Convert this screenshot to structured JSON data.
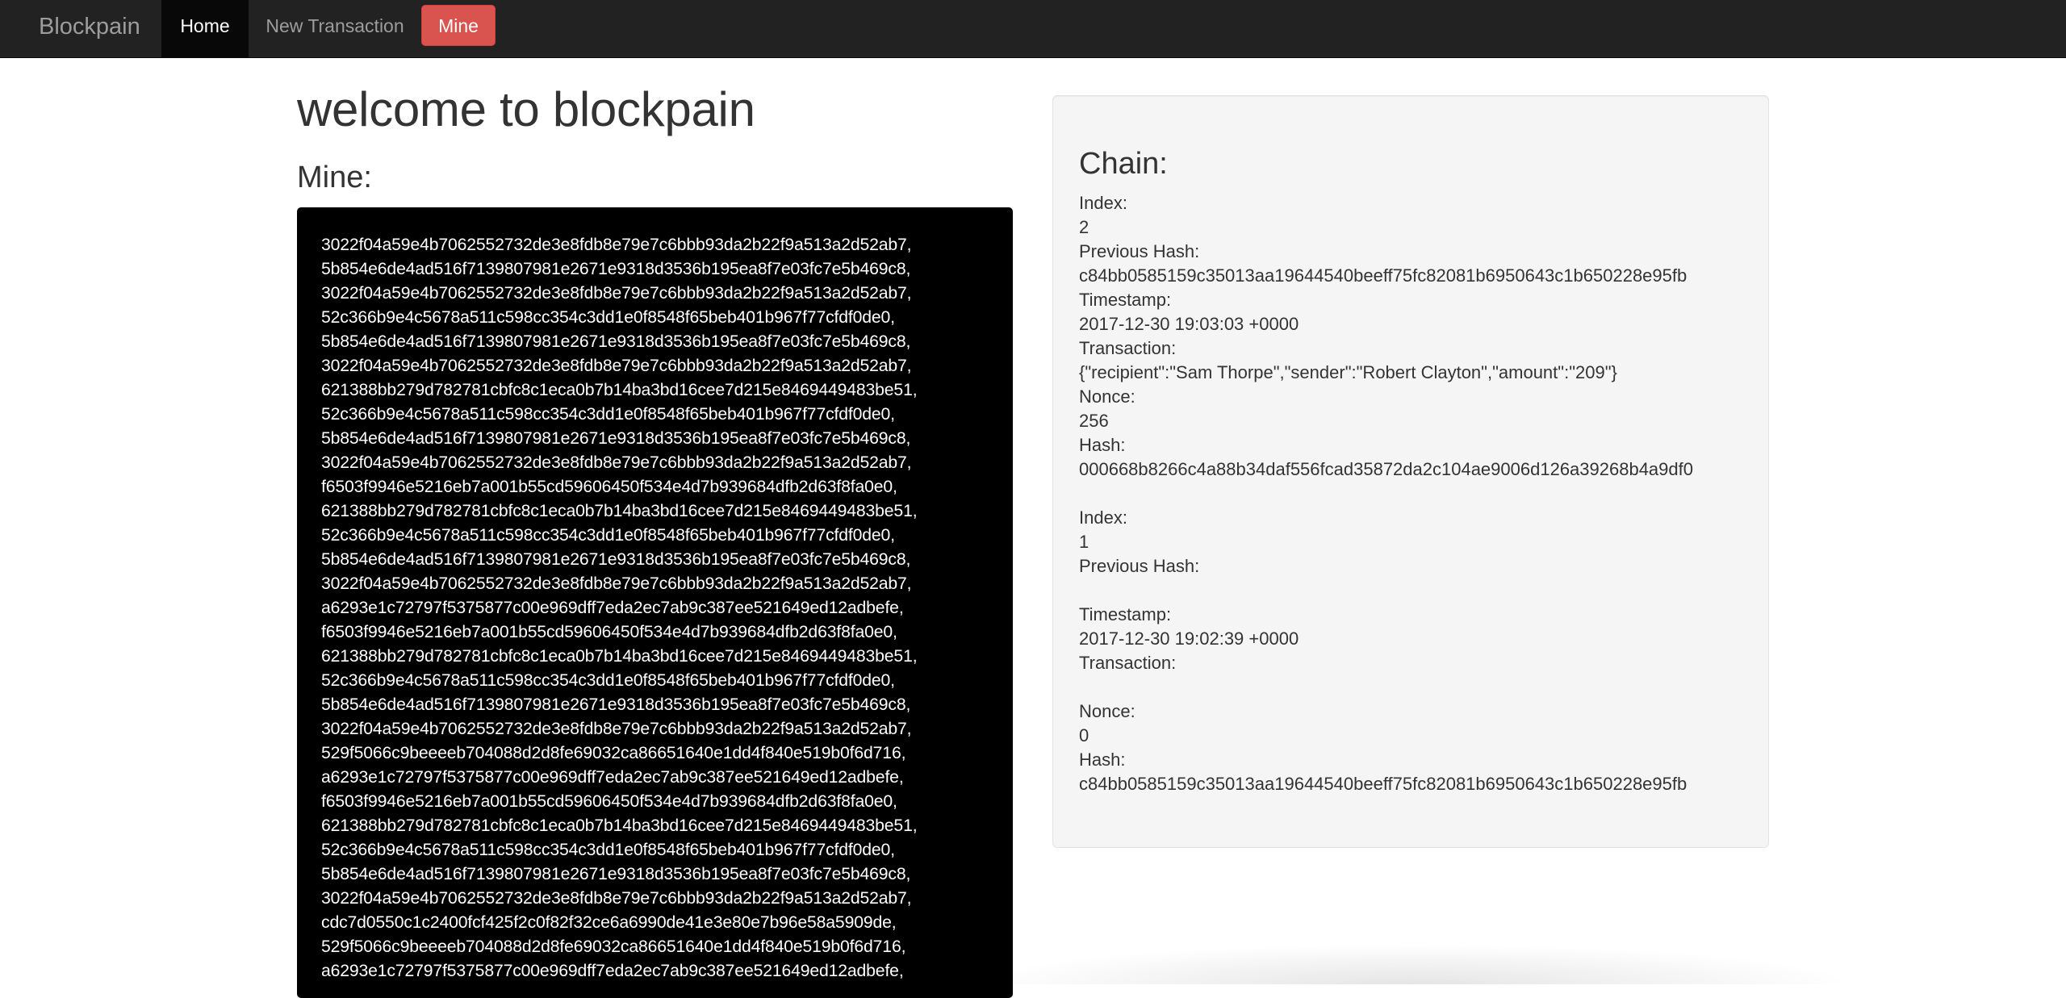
{
  "navbar": {
    "brand": "Blockpain",
    "home_label": "Home",
    "new_transaction_label": "New Transaction",
    "mine_label": "Mine"
  },
  "main": {
    "title": "welcome to blockpain",
    "mine_heading": "Mine:",
    "mine_hashes": [
      "3022f04a59e4b7062552732de3e8fdb8e79e7c6bbb93da2b22f9a513a2d52ab7,",
      "5b854e6de4ad516f7139807981e2671e9318d3536b195ea8f7e03fc7e5b469c8,",
      "3022f04a59e4b7062552732de3e8fdb8e79e7c6bbb93da2b22f9a513a2d52ab7,",
      "52c366b9e4c5678a511c598cc354c3dd1e0f8548f65beb401b967f77cfdf0de0,",
      "5b854e6de4ad516f7139807981e2671e9318d3536b195ea8f7e03fc7e5b469c8,",
      "3022f04a59e4b7062552732de3e8fdb8e79e7c6bbb93da2b22f9a513a2d52ab7,",
      "621388bb279d782781cbfc8c1eca0b7b14ba3bd16cee7d215e8469449483be51,",
      "52c366b9e4c5678a511c598cc354c3dd1e0f8548f65beb401b967f77cfdf0de0,",
      "5b854e6de4ad516f7139807981e2671e9318d3536b195ea8f7e03fc7e5b469c8,",
      "3022f04a59e4b7062552732de3e8fdb8e79e7c6bbb93da2b22f9a513a2d52ab7,",
      "f6503f9946e5216eb7a001b55cd59606450f534e4d7b939684dfb2d63f8fa0e0,",
      "621388bb279d782781cbfc8c1eca0b7b14ba3bd16cee7d215e8469449483be51,",
      "52c366b9e4c5678a511c598cc354c3dd1e0f8548f65beb401b967f77cfdf0de0,",
      "5b854e6de4ad516f7139807981e2671e9318d3536b195ea8f7e03fc7e5b469c8,",
      "3022f04a59e4b7062552732de3e8fdb8e79e7c6bbb93da2b22f9a513a2d52ab7,",
      "a6293e1c72797f5375877c00e969dff7eda2ec7ab9c387ee521649ed12adbefe,",
      "f6503f9946e5216eb7a001b55cd59606450f534e4d7b939684dfb2d63f8fa0e0,",
      "621388bb279d782781cbfc8c1eca0b7b14ba3bd16cee7d215e8469449483be51,",
      "52c366b9e4c5678a511c598cc354c3dd1e0f8548f65beb401b967f77cfdf0de0,",
      "5b854e6de4ad516f7139807981e2671e9318d3536b195ea8f7e03fc7e5b469c8,",
      "3022f04a59e4b7062552732de3e8fdb8e79e7c6bbb93da2b22f9a513a2d52ab7,",
      "529f5066c9beeeeb704088d2d8fe69032ca86651640e1dd4f840e519b0f6d716,",
      "a6293e1c72797f5375877c00e969dff7eda2ec7ab9c387ee521649ed12adbefe,",
      "f6503f9946e5216eb7a001b55cd59606450f534e4d7b939684dfb2d63f8fa0e0,",
      "621388bb279d782781cbfc8c1eca0b7b14ba3bd16cee7d215e8469449483be51,",
      "52c366b9e4c5678a511c598cc354c3dd1e0f8548f65beb401b967f77cfdf0de0,",
      "5b854e6de4ad516f7139807981e2671e9318d3536b195ea8f7e03fc7e5b469c8,",
      "3022f04a59e4b7062552732de3e8fdb8e79e7c6bbb93da2b22f9a513a2d52ab7,",
      "cdc7d0550c1c2400fcf425f2c0f82f32ce6a6990de41e3e80e7b96e58a5909de,",
      "529f5066c9beeeeb704088d2d8fe69032ca86651640e1dd4f840e519b0f6d716,",
      "a6293e1c72797f5375877c00e969dff7eda2ec7ab9c387ee521649ed12adbefe,"
    ]
  },
  "chain": {
    "title": "Chain:",
    "blocks": [
      {
        "index_label": "Index:",
        "index": "2",
        "prev_hash_label": "Previous Hash:",
        "prev_hash": "c84bb0585159c35013aa19644540beeff75fc82081b6950643c1b650228e95fb",
        "timestamp_label": "Timestamp:",
        "timestamp": "2017-12-30 19:03:03 +0000",
        "transaction_label": "Transaction:",
        "transaction": "{\"recipient\":\"Sam Thorpe\",\"sender\":\"Robert Clayton\",\"amount\":\"209\"}",
        "nonce_label": "Nonce:",
        "nonce": "256",
        "hash_label": "Hash:",
        "hash": "000668b8266c4a88b34daf556fcad35872da2c104ae9006d126a39268b4a9df0"
      },
      {
        "index_label": "Index:",
        "index": "1",
        "prev_hash_label": "Previous Hash:",
        "prev_hash": "",
        "timestamp_label": "Timestamp:",
        "timestamp": "2017-12-30 19:02:39 +0000",
        "transaction_label": "Transaction:",
        "transaction": "",
        "nonce_label": "Nonce:",
        "nonce": "0",
        "hash_label": "Hash:",
        "hash": "c84bb0585159c35013aa19644540beeff75fc82081b6950643c1b650228e95fb"
      }
    ]
  }
}
